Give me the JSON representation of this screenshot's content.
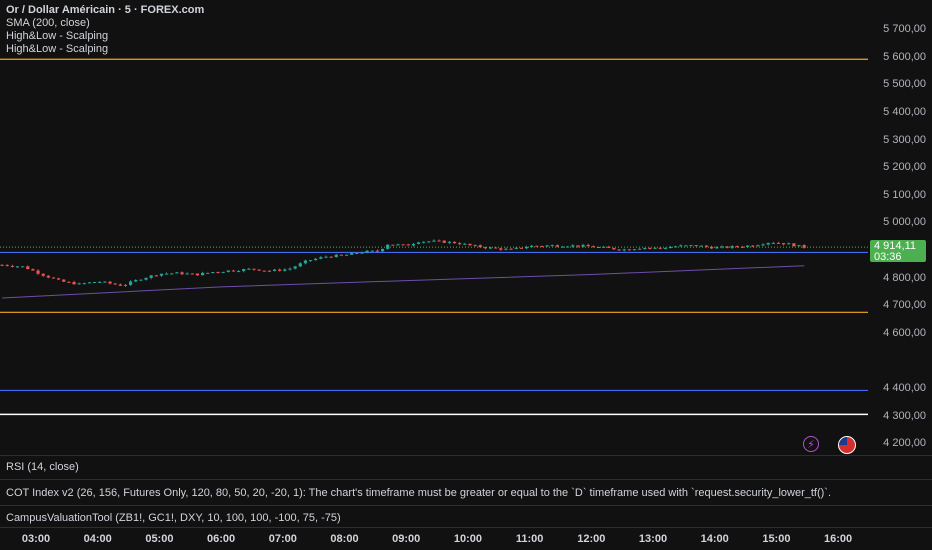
{
  "legend": {
    "symbol": "Or / Dollar Américain · 5 · FOREX.com",
    "indicators": [
      "SMA (200, close)",
      "High&Low - Scalping",
      "High&Low - Scalping"
    ]
  },
  "last_price": {
    "value": "4 914,11",
    "countdown": "03:36"
  },
  "panes": {
    "rsi": "RSI (14, close)",
    "cot": "COT Index v2 (26, 156, Futures Only, 120, 80, 50, 20, -20, 1): The chart's timeframe must be greater or equal to the `D` timeframe used with `request.security_lower_tf()`.",
    "campus": "CampusValuationTool (ZB1!, GC1!, DXY, 10, 100, 100, -100, 75, -75)"
  },
  "icons": [
    "lightning-icon",
    "us-flag-icon"
  ],
  "colors": {
    "up": "#26a69a",
    "down": "#ef5350",
    "orange": "#f5a623",
    "blue": "#3d6df2",
    "sma": "#6c4fa8",
    "white": "#ffffff"
  },
  "chart_data": {
    "type": "candlestick",
    "title": "Or / Dollar Américain · 5 · FOREX.com",
    "y_ticks": [
      "5 700,00",
      "5 600,00",
      "5 500,00",
      "5 400,00",
      "5 300,00",
      "5 200,00",
      "5 100,00",
      "5 000,00",
      "4 800,00",
      "4 700,00",
      "4 600,00",
      "4 400,00",
      "4 300,00",
      "4 200,00"
    ],
    "ylim": [
      4190,
      5730
    ],
    "x_ticks": [
      "03:00",
      "04:00",
      "05:00",
      "06:00",
      "07:00",
      "08:00",
      "09:00",
      "10:00",
      "11:00",
      "12:00",
      "13:00",
      "14:00",
      "15:00",
      "16:00"
    ],
    "x_tick_hours": [
      3,
      4,
      5,
      6,
      7,
      8,
      9,
      10,
      11,
      12,
      13,
      14,
      15,
      16
    ],
    "xlim_hours": [
      2.45,
      16.6
    ],
    "horizontal_levels": [
      {
        "price": 5595,
        "color": "orange"
      },
      {
        "price": 4895,
        "color": "blue"
      },
      {
        "price": 4678,
        "color": "orange"
      },
      {
        "price": 4395,
        "color": "blue"
      },
      {
        "price": 4308,
        "color": "white"
      }
    ],
    "last_price_value": 4914.11,
    "close_path": [
      [
        2.45,
        4850
      ],
      [
        2.8,
        4843
      ],
      [
        3.1,
        4815
      ],
      [
        3.4,
        4790
      ],
      [
        3.7,
        4780
      ],
      [
        4.0,
        4790
      ],
      [
        4.4,
        4775
      ],
      [
        4.7,
        4800
      ],
      [
        5.0,
        4818
      ],
      [
        5.3,
        4820
      ],
      [
        5.6,
        4815
      ],
      [
        5.9,
        4825
      ],
      [
        6.2,
        4830
      ],
      [
        6.5,
        4835
      ],
      [
        6.8,
        4828
      ],
      [
        7.1,
        4835
      ],
      [
        7.4,
        4865
      ],
      [
        7.7,
        4880
      ],
      [
        8.0,
        4885
      ],
      [
        8.3,
        4897
      ],
      [
        8.55,
        4900
      ],
      [
        8.7,
        4925
      ],
      [
        9.0,
        4920
      ],
      [
        9.2,
        4935
      ],
      [
        9.5,
        4935
      ],
      [
        9.8,
        4930
      ],
      [
        10.1,
        4918
      ],
      [
        10.4,
        4910
      ],
      [
        10.7,
        4905
      ],
      [
        11.0,
        4918
      ],
      [
        11.3,
        4920
      ],
      [
        11.6,
        4920
      ],
      [
        11.9,
        4918
      ],
      [
        12.2,
        4912
      ],
      [
        12.5,
        4905
      ],
      [
        12.8,
        4912
      ],
      [
        13.1,
        4910
      ],
      [
        13.4,
        4918
      ],
      [
        13.7,
        4920
      ],
      [
        14.0,
        4912
      ],
      [
        14.3,
        4915
      ],
      [
        14.6,
        4920
      ],
      [
        14.9,
        4933
      ],
      [
        15.2,
        4925
      ],
      [
        15.45,
        4914
      ]
    ],
    "sma_200": [
      [
        2.45,
        4730
      ],
      [
        6.0,
        4770
      ],
      [
        9.0,
        4793
      ],
      [
        12.0,
        4815
      ],
      [
        15.45,
        4847
      ]
    ]
  }
}
